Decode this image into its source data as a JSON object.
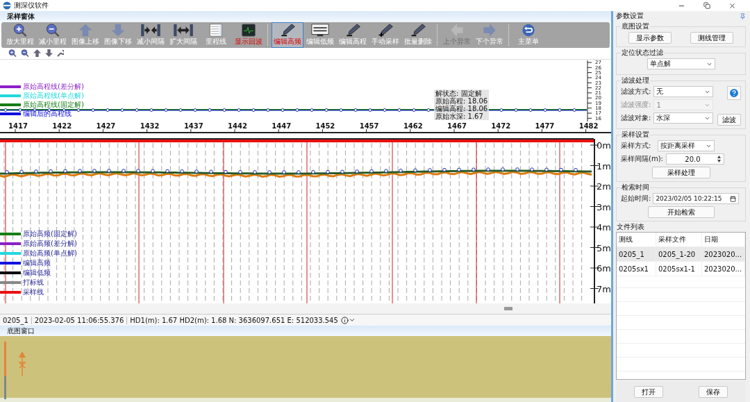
{
  "window": {
    "title": "测深仪软件"
  },
  "sampling_window": {
    "title": "采样窗体",
    "toolbar": [
      {
        "kind": "button",
        "label": "放大里程",
        "highlighted": false,
        "selected": false,
        "disabled": false
      },
      {
        "kind": "button",
        "label": "减小里程",
        "highlighted": false,
        "selected": false,
        "disabled": false
      },
      {
        "kind": "button",
        "label": "图像上移",
        "highlighted": false,
        "selected": false,
        "disabled": false
      },
      {
        "kind": "button",
        "label": "图像下移",
        "highlighted": false,
        "selected": false,
        "disabled": false
      },
      {
        "kind": "button",
        "label": "减小间隔",
        "highlighted": false,
        "selected": false,
        "disabled": false
      },
      {
        "kind": "button",
        "label": "扩大间隔",
        "highlighted": false,
        "selected": false,
        "disabled": false
      },
      {
        "kind": "button",
        "label": "里程线",
        "highlighted": false,
        "selected": false,
        "disabled": false
      },
      {
        "kind": "button",
        "label": "显示回波",
        "highlighted": true,
        "selected": false,
        "disabled": false
      },
      {
        "kind": "separator"
      },
      {
        "kind": "button",
        "label": "编辑高频",
        "highlighted": true,
        "selected": true,
        "disabled": false
      },
      {
        "kind": "button",
        "label": "编辑低频",
        "highlighted": false,
        "selected": false,
        "disabled": false
      },
      {
        "kind": "button",
        "label": "编辑高程",
        "highlighted": false,
        "selected": false,
        "disabled": false
      },
      {
        "kind": "button",
        "label": "手动采样",
        "highlighted": false,
        "selected": false,
        "disabled": false
      },
      {
        "kind": "button",
        "label": "批量删除",
        "highlighted": false,
        "selected": false,
        "disabled": false
      },
      {
        "kind": "separator"
      },
      {
        "kind": "button",
        "label": "上个异常",
        "highlighted": false,
        "selected": false,
        "disabled": true
      },
      {
        "kind": "button",
        "label": "下个异常",
        "highlighted": false,
        "selected": false,
        "disabled": false
      },
      {
        "kind": "separator"
      },
      {
        "kind": "button",
        "label": "主菜单",
        "highlighted": false,
        "selected": false,
        "disabled": false
      }
    ],
    "elevation_chart": {
      "legend": [
        {
          "label": "原始高程线(差分解)",
          "color": "#8a1fc8"
        },
        {
          "label": "原始高程线(单点解)",
          "color": "#22d8e0"
        },
        {
          "label": "原始高程线(固定解)",
          "color": "#167d16"
        },
        {
          "label": "编辑后的高程线",
          "color": "#1010e0"
        }
      ],
      "scale": [
        "27",
        "26",
        "25",
        "24",
        "23",
        "22",
        "21",
        "20",
        "19",
        "18",
        "17",
        "16"
      ],
      "tooltip": [
        "解状态: 固定解",
        "原始高程: 18.06",
        "编辑高程: 18.06",
        "原始水深: 1.67"
      ]
    },
    "mileage_ticks": [
      "1417",
      "1422",
      "1427",
      "1432",
      "1437",
      "1442",
      "1447",
      "1452",
      "1457",
      "1462",
      "1467",
      "1472",
      "1477",
      "1482"
    ],
    "echogram": {
      "depth_labels": [
        "0m",
        "1m",
        "2m",
        "3m",
        "4m",
        "5m",
        "6m",
        "7m"
      ],
      "legend": [
        {
          "label": "原始高频(固定解)",
          "color": "#167d16"
        },
        {
          "label": "原始高频(差分解)",
          "color": "#8a1fc8"
        },
        {
          "label": "原始高频(单点解)",
          "color": "#22d8e0"
        },
        {
          "label": "编辑高频",
          "color": "#1010e0"
        },
        {
          "label": "编辑低频",
          "color": "#000000"
        },
        {
          "label": "打标线",
          "color": "#888888"
        },
        {
          "label": "采样线",
          "color": "#e81010"
        }
      ]
    },
    "status_bar": {
      "line": "0205_1",
      "time": "2023-02-05 11:06:55.376",
      "readout": "HD1(m): 1.67 HD2(m): 1.68 N: 3636097.651 E: 512033.545"
    }
  },
  "basemap_window": {
    "title": "底图窗口"
  },
  "parameters": {
    "title": "参数设置",
    "basemap": {
      "title": "底图设置",
      "buttons": [
        "显示参数",
        "测线管理"
      ]
    },
    "position_filter": {
      "title": "定位状态过滤",
      "value": "单点解"
    },
    "filtering": {
      "title": "滤波处理",
      "fields": [
        {
          "label": "滤波方式:",
          "value": "无",
          "disabled": false
        },
        {
          "label": "滤波强度:",
          "value": "1",
          "disabled": true
        },
        {
          "label": "滤波对象:",
          "value": "水深",
          "disabled": false
        }
      ],
      "button": "滤波"
    },
    "sampling": {
      "title": "采样设置",
      "method_label": "采样方式:",
      "method": "按距离采样",
      "interval_label": "采样间隔(m):",
      "interval": "20.0",
      "button": "采样处理"
    },
    "search": {
      "title": "检索时间",
      "label": "起始时间:",
      "value": "2023/02/05 10:22:15",
      "button": "开始检索"
    },
    "files": {
      "title": "文件列表",
      "columns": [
        "测线",
        "采样文件",
        "日期"
      ],
      "rows": [
        {
          "cells": [
            "0205_1",
            "0205_1-20",
            "2023020..."
          ],
          "selected": true
        },
        {
          "cells": [
            "0205sx1",
            "0205sx1-1",
            "2023020..."
          ],
          "selected": false
        }
      ]
    },
    "buttons": [
      "打开",
      "保存"
    ]
  }
}
